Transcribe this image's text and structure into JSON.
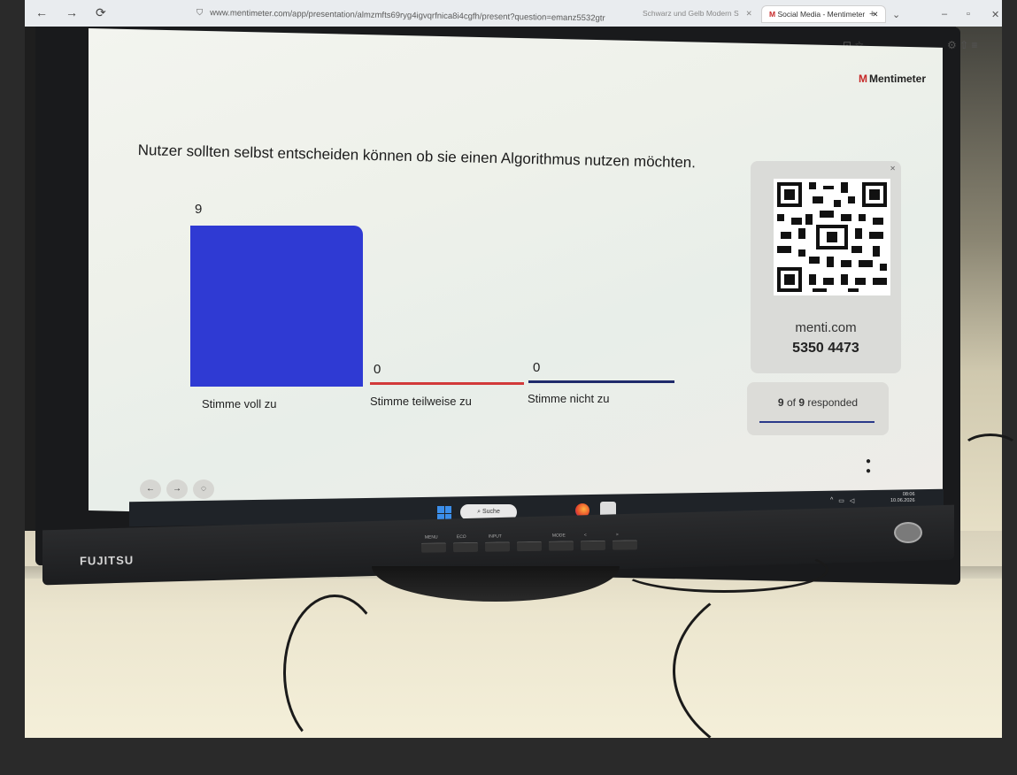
{
  "browser": {
    "url": "www.mentimeter.com/app/presentation/almzmfts69ryg4igvqrfnica8i4cgfh/present?question=emanz5532gtr",
    "tabs": [
      {
        "label": "Schwarz und Gelb Modern S"
      },
      {
        "label": "Social Media - Mentimeter"
      }
    ]
  },
  "slide": {
    "logo": "Mentimeter",
    "question": "Nutzer sollten selbst entscheiden können ob sie einen Algorithmus nutzen möchten.",
    "chart_data": {
      "type": "bar",
      "categories": [
        "Stimme voll zu",
        "Stimme teilweise zu",
        "Stimme nicht zu"
      ],
      "values": [
        9,
        0,
        0
      ],
      "colors": [
        "#2f3ad3",
        "#d23a3a",
        "#1f2a6b"
      ]
    },
    "labels": {
      "v1": "9",
      "v2": "0",
      "v3": "0",
      "c1": "Stimme voll zu",
      "c2": "Stimme teilweise zu",
      "c3": "Stimme nicht zu"
    },
    "join": {
      "url": "menti.com",
      "code": "5350 4473"
    },
    "responded": {
      "count": "9",
      "of": "of",
      "total": "9",
      "suffix": "responded"
    }
  },
  "taskbar": {
    "search": "Suche",
    "time": "08:06",
    "date": "10.06.2026"
  },
  "monitor": {
    "brand": "FUJITSU",
    "buttons": [
      "MENU",
      "ECO",
      "INPUT",
      "",
      "MODE",
      "<",
      ">"
    ]
  }
}
